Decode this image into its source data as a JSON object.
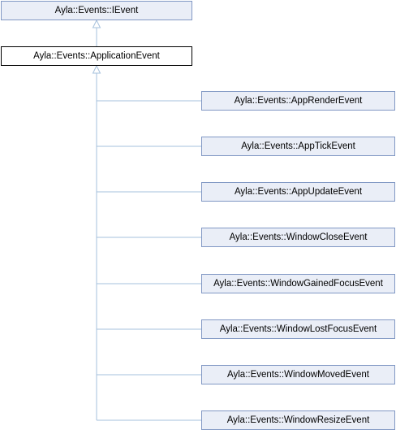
{
  "diagram": {
    "base": "Ayla::Events::IEvent",
    "current": "Ayla::Events::ApplicationEvent",
    "derived": [
      "Ayla::Events::AppRenderEvent",
      "Ayla::Events::AppTickEvent",
      "Ayla::Events::AppUpdateEvent",
      "Ayla::Events::WindowCloseEvent",
      "Ayla::Events::WindowGainedFocusEvent",
      "Ayla::Events::WindowLostFocusEvent",
      "Ayla::Events::WindowMovedEvent",
      "Ayla::Events::WindowResizeEvent"
    ],
    "colors": {
      "node_fill": "#eaeef7",
      "node_border": "#8198c4",
      "edge": "#a6c0dc",
      "current_border": "#000000"
    }
  }
}
